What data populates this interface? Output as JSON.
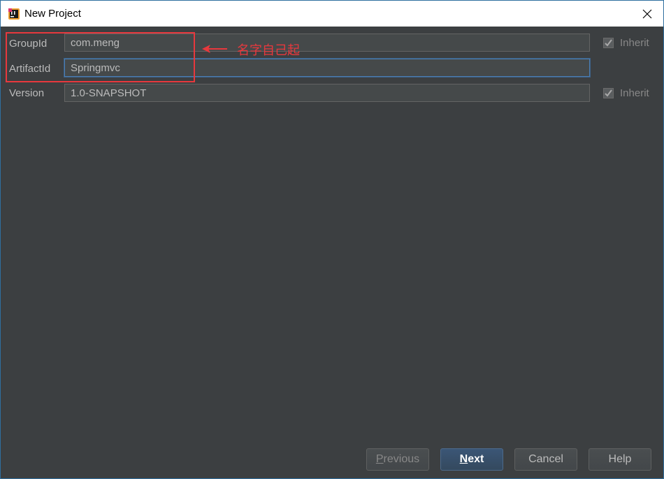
{
  "window": {
    "title": "New Project",
    "icon": "intellij-idea-icon"
  },
  "form": {
    "group_id": {
      "label": "GroupId",
      "value": "com.meng",
      "inherit_label": "Inherit",
      "inherit_checked": true
    },
    "artifact_id": {
      "label": "ArtifactId",
      "value": "Springmvc"
    },
    "version": {
      "label": "Version",
      "value": "1.0-SNAPSHOT",
      "inherit_label": "Inherit",
      "inherit_checked": true
    }
  },
  "annotation": {
    "text": "名字自己起",
    "color": "#e8383d"
  },
  "buttons": {
    "previous": {
      "mnemonic": "P",
      "rest": "revious",
      "enabled": false
    },
    "next": {
      "mnemonic": "N",
      "rest": "ext",
      "enabled": true
    },
    "cancel": "Cancel",
    "help": "Help"
  },
  "colors": {
    "background": "#3c3f41",
    "text": "#bbbbbb",
    "primary_button": "#3b5676",
    "focus_border": "#4b7db2"
  }
}
